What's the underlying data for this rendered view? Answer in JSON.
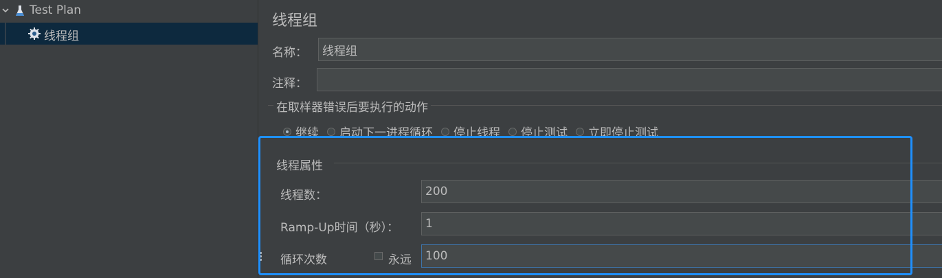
{
  "tree": {
    "root_label": "Test Plan",
    "child_label": "线程组"
  },
  "main": {
    "title": "线程组",
    "name_label": "名称：",
    "name_value": "线程组",
    "comment_label": "注释：",
    "comment_value": "",
    "error_section": {
      "title": "在取样器错误后要执行的动作",
      "options": [
        "继续",
        "启动下一进程循环",
        "停止线程",
        "停止测试",
        "立即停止测试"
      ],
      "selected": "继续"
    },
    "thread_section": {
      "title": "线程属性",
      "threads_label": "线程数：",
      "threads_value": "200",
      "rampup_label": "Ramp-Up时间（秒）：",
      "rampup_value": "1",
      "loop_label": "循环次数",
      "forever_label": "永远",
      "forever_checked": false,
      "loop_value": "100"
    }
  },
  "colors": {
    "background": "#3c3f41",
    "selection": "#0d293e",
    "highlight_border": "#1e90ff",
    "text": "#bbbbbb",
    "field_bg": "#45494a"
  },
  "icons": {
    "tree_toggle": "chevron-down-icon",
    "test_plan": "flask-icon",
    "thread_group": "gear-icon"
  }
}
